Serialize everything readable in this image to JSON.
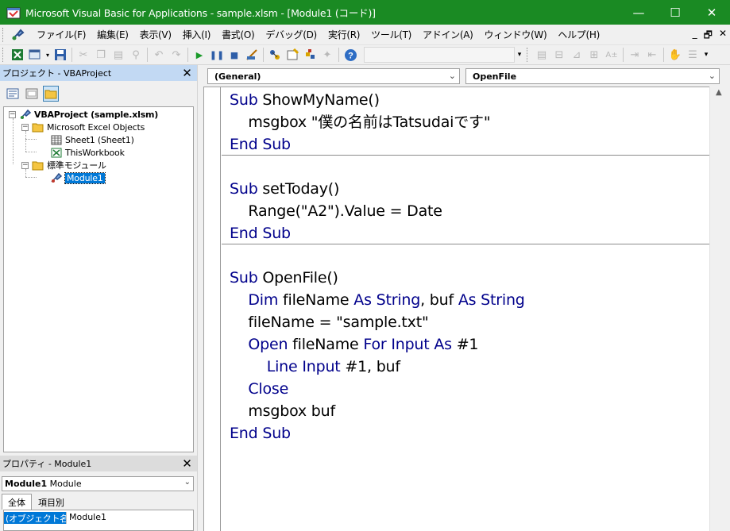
{
  "window": {
    "title": "Microsoft Visual Basic for Applications - sample.xlsm - [Module1 (コード)]",
    "minimize": "—",
    "maximize": "☐",
    "close": "✕"
  },
  "menu": {
    "items": [
      "ファイル(F)",
      "編集(E)",
      "表示(V)",
      "挿入(I)",
      "書式(O)",
      "デバッグ(D)",
      "実行(R)",
      "ツール(T)",
      "アドイン(A)",
      "ウィンドウ(W)",
      "ヘルプ(H)"
    ],
    "mdi_minimize": "_",
    "mdi_restore": "🗗",
    "mdi_close": "✕"
  },
  "project_panel": {
    "title": "プロジェクト - VBAProject",
    "close": "✕",
    "tree": {
      "root": "VBAProject (sample.xlsm)",
      "excel_objects": "Microsoft Excel Objects",
      "sheet1": "Sheet1 (Sheet1)",
      "thisworkbook": "ThisWorkbook",
      "modules_folder": "標準モジュール",
      "module1": "Module1"
    }
  },
  "properties_panel": {
    "title": "プロパティ - Module1",
    "close": "✕",
    "object_name": "Module1",
    "object_type": "Module",
    "tabs": [
      "全体",
      "項目別"
    ],
    "row_name": "(オブジェクト名)",
    "row_value": "Module1"
  },
  "code_window": {
    "object_combo": "(General)",
    "procedure_combo": "OpenFile",
    "lines": [
      [
        {
          "kw": true,
          "t": "Sub "
        },
        {
          "kw": false,
          "t": "ShowMyName()"
        }
      ],
      [
        {
          "kw": false,
          "t": "    msgbox \"僕の名前はTatsudaiです\""
        }
      ],
      [
        {
          "kw": true,
          "t": "End Sub"
        }
      ],
      [],
      [
        {
          "kw": true,
          "t": "Sub "
        },
        {
          "kw": false,
          "t": "setToday()"
        }
      ],
      [
        {
          "kw": false,
          "t": "    Range(\"A2\").Value = Date"
        }
      ],
      [
        {
          "kw": true,
          "t": "End Sub"
        }
      ],
      [],
      [
        {
          "kw": true,
          "t": "Sub "
        },
        {
          "kw": false,
          "t": "OpenFile()"
        }
      ],
      [
        {
          "kw": false,
          "t": "    "
        },
        {
          "kw": true,
          "t": "Dim "
        },
        {
          "kw": false,
          "t": "fileName "
        },
        {
          "kw": true,
          "t": "As String"
        },
        {
          "kw": false,
          "t": ", buf "
        },
        {
          "kw": true,
          "t": "As String"
        }
      ],
      [
        {
          "kw": false,
          "t": "    fileName = \"sample.txt\""
        }
      ],
      [
        {
          "kw": false,
          "t": "    "
        },
        {
          "kw": true,
          "t": "Open "
        },
        {
          "kw": false,
          "t": "fileName "
        },
        {
          "kw": true,
          "t": "For Input As "
        },
        {
          "kw": false,
          "t": "#1"
        }
      ],
      [
        {
          "kw": false,
          "t": "        "
        },
        {
          "kw": true,
          "t": "Line Input "
        },
        {
          "kw": false,
          "t": "#1, buf"
        }
      ],
      [
        {
          "kw": false,
          "t": "    "
        },
        {
          "kw": true,
          "t": "Close"
        }
      ],
      [
        {
          "kw": false,
          "t": "    msgbox buf"
        }
      ],
      [
        {
          "kw": true,
          "t": "End Sub"
        }
      ]
    ]
  },
  "colors": {
    "titlebar": "#1a8a23",
    "keyword": "#00008b",
    "selection": "#0078d7",
    "panel_title": "#c2d9f3"
  }
}
